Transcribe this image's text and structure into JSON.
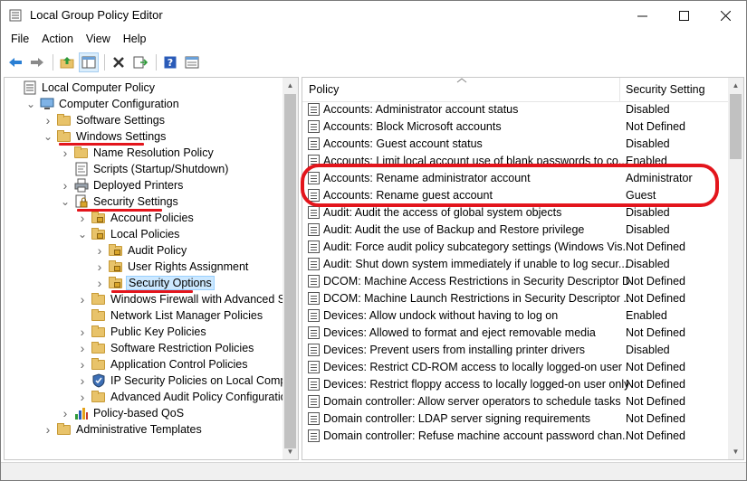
{
  "window": {
    "title": "Local Group Policy Editor"
  },
  "menu": [
    "File",
    "Action",
    "View",
    "Help"
  ],
  "toolbar": [
    "back-icon",
    "forward-icon",
    "up-folder-icon",
    "show-hide-tree-icon",
    "delete-icon",
    "export-list-icon",
    "help-icon",
    "properties-icon"
  ],
  "tree": [
    {
      "label": "Local Computer Policy",
      "depth": 0,
      "exp": "",
      "icon": "computer-policy-icon"
    },
    {
      "label": "Computer Configuration",
      "depth": 1,
      "exp": "down",
      "icon": "computer-icon"
    },
    {
      "label": "Software Settings",
      "depth": 2,
      "exp": "right",
      "icon": "folder-icon"
    },
    {
      "label": "Windows Settings",
      "depth": 2,
      "exp": "down",
      "icon": "folder-icon"
    },
    {
      "label": "Name Resolution Policy",
      "depth": 3,
      "exp": "right",
      "icon": "folder-icon"
    },
    {
      "label": "Scripts (Startup/Shutdown)",
      "depth": 3,
      "exp": "",
      "icon": "scripts-icon"
    },
    {
      "label": "Deployed Printers",
      "depth": 3,
      "exp": "right",
      "icon": "printer-icon"
    },
    {
      "label": "Security Settings",
      "depth": 3,
      "exp": "down",
      "icon": "security-settings-icon"
    },
    {
      "label": "Account Policies",
      "depth": 4,
      "exp": "right",
      "icon": "locked-folder-icon"
    },
    {
      "label": "Local Policies",
      "depth": 4,
      "exp": "down",
      "icon": "locked-folder-icon"
    },
    {
      "label": "Audit Policy",
      "depth": 5,
      "exp": "right",
      "icon": "locked-folder-icon"
    },
    {
      "label": "User Rights Assignment",
      "depth": 5,
      "exp": "right",
      "icon": "locked-folder-icon"
    },
    {
      "label": "Security Options",
      "depth": 5,
      "exp": "right",
      "icon": "locked-folder-icon",
      "selected": true
    },
    {
      "label": "Windows Firewall with Advanced Secur",
      "depth": 4,
      "exp": "right",
      "icon": "folder-icon"
    },
    {
      "label": "Network List Manager Policies",
      "depth": 4,
      "exp": "",
      "icon": "folder-icon"
    },
    {
      "label": "Public Key Policies",
      "depth": 4,
      "exp": "right",
      "icon": "folder-icon"
    },
    {
      "label": "Software Restriction Policies",
      "depth": 4,
      "exp": "right",
      "icon": "folder-icon"
    },
    {
      "label": "Application Control Policies",
      "depth": 4,
      "exp": "right",
      "icon": "folder-icon"
    },
    {
      "label": "IP Security Policies on Local Computer",
      "depth": 4,
      "exp": "right",
      "icon": "ip-security-icon"
    },
    {
      "label": "Advanced Audit Policy Configuration",
      "depth": 4,
      "exp": "right",
      "icon": "folder-icon"
    },
    {
      "label": "Policy-based QoS",
      "depth": 3,
      "exp": "right",
      "icon": "qos-chart-icon"
    },
    {
      "label": "Administrative Templates",
      "depth": 2,
      "exp": "right",
      "icon": "folder-icon"
    }
  ],
  "list": {
    "col_policy": "Policy",
    "col_setting": "Security Setting",
    "rows": [
      {
        "policy": "Accounts: Administrator account status",
        "setting": "Disabled"
      },
      {
        "policy": "Accounts: Block Microsoft accounts",
        "setting": "Not Defined"
      },
      {
        "policy": "Accounts: Guest account status",
        "setting": "Disabled"
      },
      {
        "policy": "Accounts: Limit local account use of blank passwords to co...",
        "setting": "Enabled"
      },
      {
        "policy": "Accounts: Rename administrator account",
        "setting": "Administrator"
      },
      {
        "policy": "Accounts: Rename guest account",
        "setting": "Guest"
      },
      {
        "policy": "Audit: Audit the access of global system objects",
        "setting": "Disabled"
      },
      {
        "policy": "Audit: Audit the use of Backup and Restore privilege",
        "setting": "Disabled"
      },
      {
        "policy": "Audit: Force audit policy subcategory settings (Windows Vis...",
        "setting": "Not Defined"
      },
      {
        "policy": "Audit: Shut down system immediately if unable to log secur...",
        "setting": "Disabled"
      },
      {
        "policy": "DCOM: Machine Access Restrictions in Security Descriptor D...",
        "setting": "Not Defined"
      },
      {
        "policy": "DCOM: Machine Launch Restrictions in Security Descriptor ...",
        "setting": "Not Defined"
      },
      {
        "policy": "Devices: Allow undock without having to log on",
        "setting": "Enabled"
      },
      {
        "policy": "Devices: Allowed to format and eject removable media",
        "setting": "Not Defined"
      },
      {
        "policy": "Devices: Prevent users from installing printer drivers",
        "setting": "Disabled"
      },
      {
        "policy": "Devices: Restrict CD-ROM access to locally logged-on user ...",
        "setting": "Not Defined"
      },
      {
        "policy": "Devices: Restrict floppy access to locally logged-on user only",
        "setting": "Not Defined"
      },
      {
        "policy": "Domain controller: Allow server operators to schedule tasks",
        "setting": "Not Defined"
      },
      {
        "policy": "Domain controller: LDAP server signing requirements",
        "setting": "Not Defined"
      },
      {
        "policy": "Domain controller: Refuse machine account password chan...",
        "setting": "Not Defined"
      }
    ]
  },
  "colors": {
    "annotation_red": "#e3151c",
    "selection": "#cce8ff"
  }
}
